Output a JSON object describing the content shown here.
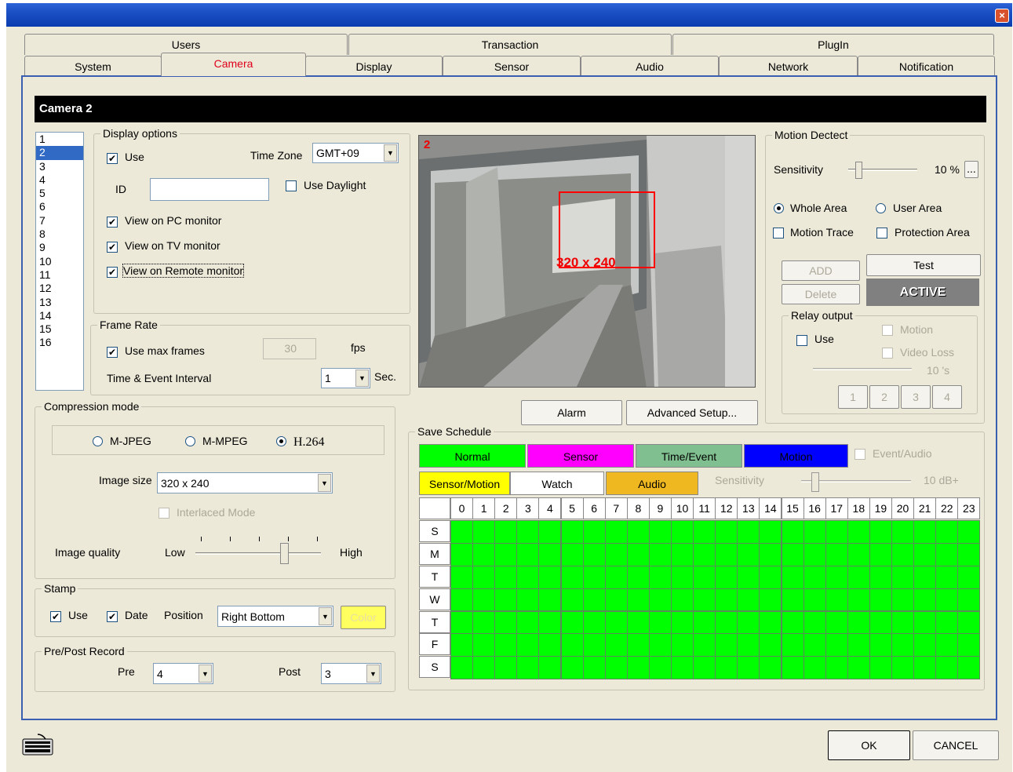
{
  "window": {
    "close": "×"
  },
  "tabs_row1": [
    "Users",
    "Transaction",
    "PlugIn"
  ],
  "tabs_row2": [
    "System",
    "Camera",
    "Display",
    "Sensor",
    "Audio",
    "Network",
    "Notification"
  ],
  "header": {
    "title": "Camera 2"
  },
  "camera_list": [
    "1",
    "2",
    "3",
    "4",
    "5",
    "6",
    "7",
    "8",
    "9",
    "10",
    "11",
    "12",
    "13",
    "14",
    "15",
    "16"
  ],
  "display_options": {
    "title": "Display options",
    "use": "Use",
    "time_zone_label": "Time Zone",
    "time_zone": "GMT+09",
    "id_label": "ID",
    "id_value": "",
    "use_daylight": "Use Daylight",
    "view_pc": "View on PC monitor",
    "view_tv": "View on TV monitor",
    "view_remote": "View on Remote monitor"
  },
  "frame_rate": {
    "title": "Frame Rate",
    "use_max": "Use max frames",
    "fps_value": "30",
    "fps": "fps",
    "interval_label": "Time & Event Interval",
    "interval": "1",
    "sec": "Sec."
  },
  "compression": {
    "title": "Compression mode",
    "mjpeg": "M-JPEG",
    "mmpeg": "M-MPEG",
    "h264": "H.264",
    "image_size_label": "Image size",
    "image_size": "320 x 240",
    "interlaced": "Interlaced Mode",
    "quality_label": "Image quality",
    "low": "Low",
    "high": "High",
    "quality_level": 0.75
  },
  "stamp": {
    "title": "Stamp",
    "use": "Use",
    "date": "Date",
    "position_label": "Position",
    "position": "Right Bottom",
    "color": "Color"
  },
  "prepost": {
    "title": "Pre/Post Record",
    "pre_label": "Pre",
    "pre": "4",
    "post_label": "Post",
    "post": "3"
  },
  "preview": {
    "channel": "2",
    "resolution": "320 x 240"
  },
  "buttons": {
    "alarm": "Alarm",
    "advanced": "Advanced Setup...",
    "ok": "OK",
    "cancel": "CANCEL"
  },
  "motion": {
    "title": "Motion Dectect",
    "sensitivity_label": "Sensitivity",
    "sensitivity": "10 %",
    "more": "...",
    "whole": "Whole Area",
    "user": "User Area",
    "trace": "Motion Trace",
    "protection": "Protection Area",
    "add": "ADD",
    "test": "Test",
    "delete": "Delete",
    "active": "ACTIVE",
    "relay": {
      "title": "Relay output",
      "use": "Use",
      "motion": "Motion",
      "video_loss": "Video Loss",
      "time": "10 's",
      "outputs": [
        "1",
        "2",
        "3",
        "4"
      ]
    }
  },
  "schedule": {
    "title": "Save Schedule",
    "legend": [
      {
        "label": "Normal",
        "color": "#00ff00",
        "text": "#000"
      },
      {
        "label": "Sensor",
        "color": "#ff00ff",
        "text": "#000"
      },
      {
        "label": "Time/Event",
        "color": "#80c090",
        "text": "#000"
      },
      {
        "label": "Motion",
        "color": "#0000ff",
        "text": "#000"
      },
      {
        "label": "Sensor/Motion",
        "color": "#ffff00",
        "text": "#000"
      },
      {
        "label": "Watch",
        "color": "#ffffff",
        "text": "#000"
      },
      {
        "label": "Audio",
        "color": "#f0b820",
        "text": "#000"
      }
    ],
    "event_audio": "Event/Audio",
    "sensitivity_label": "Sensitivity",
    "sensitivity": "10 dB+",
    "hours": [
      "0",
      "1",
      "2",
      "3",
      "4",
      "5",
      "6",
      "7",
      "8",
      "9",
      "10",
      "11",
      "12",
      "13",
      "14",
      "15",
      "16",
      "17",
      "18",
      "19",
      "20",
      "21",
      "22",
      "23"
    ],
    "days": [
      "S",
      "M",
      "T",
      "W",
      "T",
      "F",
      "S"
    ],
    "fill": "#00ff00"
  }
}
